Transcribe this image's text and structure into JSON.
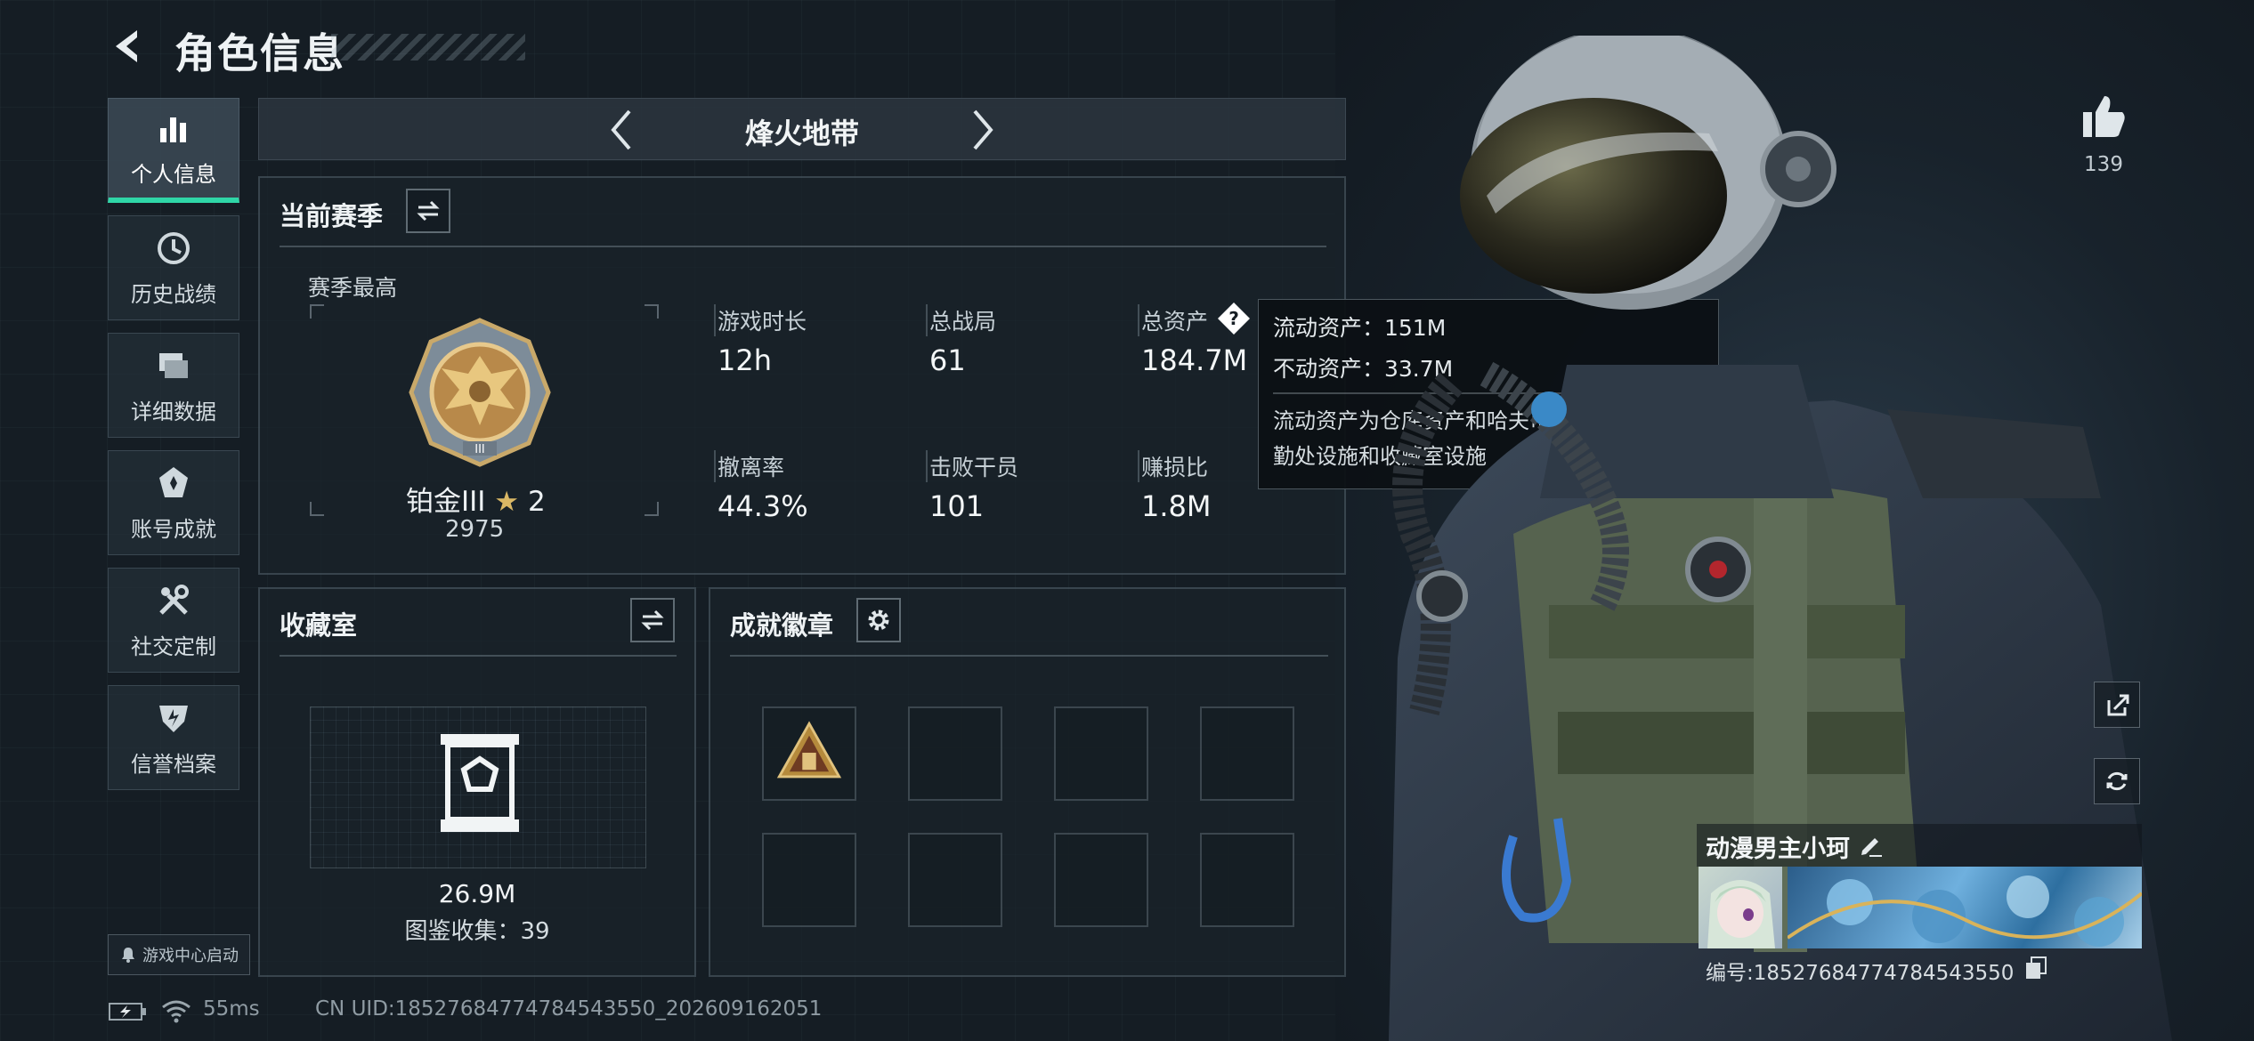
{
  "header": {
    "title": "角色信息"
  },
  "sidebar": {
    "items": [
      {
        "label": "个人信息",
        "icon": "bar-chart-icon",
        "active": true
      },
      {
        "label": "历史战绩",
        "icon": "history-clock-icon",
        "active": false
      },
      {
        "label": "详细数据",
        "icon": "stacked-cards-icon",
        "active": false
      },
      {
        "label": "账号成就",
        "icon": "achievement-emblem-icon",
        "active": false
      },
      {
        "label": "社交定制",
        "icon": "tools-icon",
        "active": false
      },
      {
        "label": "信誉档案",
        "icon": "credit-shield-icon",
        "active": false
      }
    ],
    "launch_label": "游戏中心启动"
  },
  "mode_bar": {
    "title": "烽火地带"
  },
  "season": {
    "title": "当前赛季",
    "best_label": "赛季最高",
    "rank_name": "铂金III",
    "rank_stars": "2",
    "rank_score": "2975",
    "stats": [
      {
        "label": "游戏时长",
        "value": "12h"
      },
      {
        "label": "总战局",
        "value": "61"
      },
      {
        "label": "总资产",
        "value": "184.7M"
      },
      {
        "label": "撤离率",
        "value": "44.3%"
      },
      {
        "label": "击败干员",
        "value": "101"
      },
      {
        "label": "赚损比",
        "value": "1.8M"
      }
    ]
  },
  "tooltip": {
    "liquid": "流动资产：151M",
    "fixed": "不动资产：33.7M",
    "desc": "流动资产为仓库资产和哈夫币，不动资产为特勤处设施和收藏室设施"
  },
  "collection": {
    "title": "收藏室",
    "value": "26.9M",
    "count_label": "图鉴收集：39"
  },
  "badges": {
    "title": "成就徽章",
    "slots": 8
  },
  "status": {
    "ping": "55ms",
    "uid": "CN UID:18527684774784543550_202609162051"
  },
  "profile": {
    "likes": "139",
    "name": "动漫男主小珂",
    "id_label": "编号:18527684774784543550"
  },
  "colors": {
    "accent": "#2fd6a7",
    "panel_bg": "#1a232b",
    "page_bg": "#151d24"
  }
}
